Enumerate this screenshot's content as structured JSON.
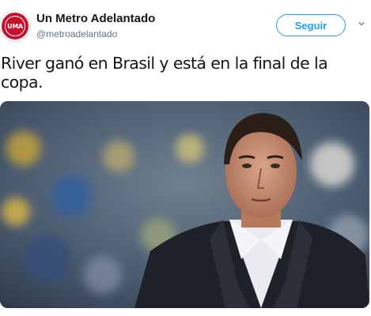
{
  "account": {
    "display_name": "Un Metro Adelantado",
    "handle": "@metroadelantado",
    "avatar_text": "UMA",
    "avatar_color": "#c8102e"
  },
  "follow_button": {
    "label": "Seguir",
    "color": "#1da1f2"
  },
  "menu": {
    "icon": "chevron-down-icon"
  },
  "tweet": {
    "text": "River ganó en Brasil y está en la final de la copa."
  },
  "media": {
    "description_icon": "photo-of-coach-in-suit"
  }
}
